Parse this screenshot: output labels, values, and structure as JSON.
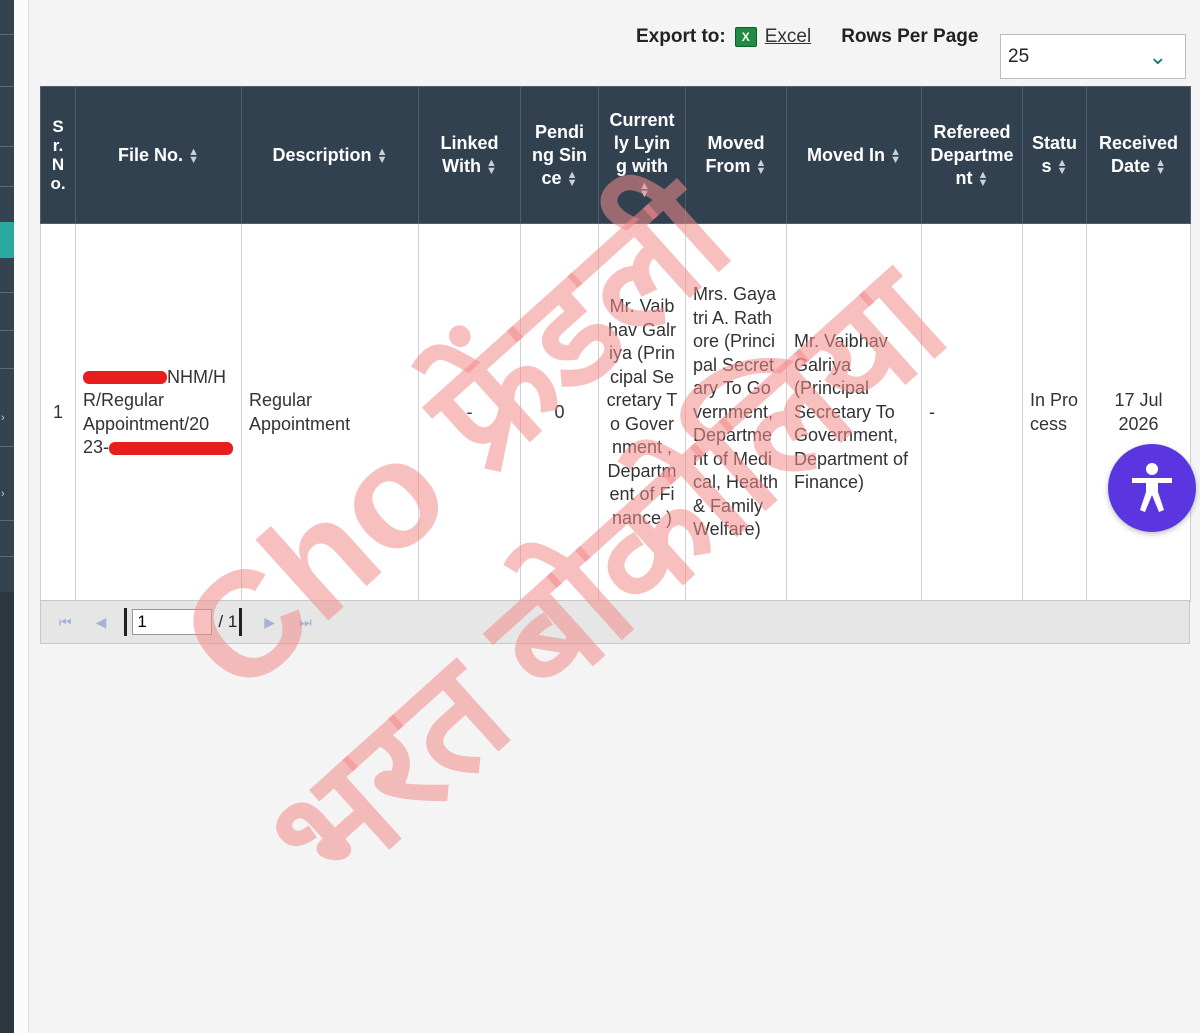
{
  "toolbar": {
    "export_label": "Export to:",
    "excel_label": "Excel",
    "excel_icon_glyph": "X",
    "rows_per_page_label": "Rows Per Page",
    "rows_per_page_value": "25"
  },
  "table": {
    "columns": [
      {
        "label": "Sr. No.",
        "sortable": false
      },
      {
        "label": "File No.",
        "sortable": true
      },
      {
        "label": "Description",
        "sortable": true
      },
      {
        "label": "Linked With",
        "sortable": true
      },
      {
        "label": "Pending Since",
        "sortable": true
      },
      {
        "label": "Currently Lying with",
        "sortable": true
      },
      {
        "label": "Moved From",
        "sortable": true
      },
      {
        "label": "Moved In",
        "sortable": true
      },
      {
        "label": "Refereed Department",
        "sortable": true
      },
      {
        "label": "Status",
        "sortable": true
      },
      {
        "label": "Received Date",
        "sortable": true
      }
    ],
    "rows": [
      {
        "sr_no": "1",
        "file_no_part1": "NHM/H",
        "file_no_part2": "R/Regular",
        "file_no_part3": "Appointment/20",
        "file_no_part4": "23-",
        "description": "Regular Appointment",
        "linked_with": "-",
        "pending_since": "0",
        "currently_lying_with": "Mr. Vaibhav Galriya (Principal Secretary To Government , Department of Finance )",
        "moved_from": "Mrs. Gayatri A. Rathore (Principal Secretary To Government, Department of Medical, Health & Family Welfare)",
        "moved_in": "Mr. Vaibhav Galriya (Principal Secretary To Government, Department of Finance)",
        "refereed_department": "-",
        "status": "In Process",
        "received_date": "17 Jul 2026"
      }
    ]
  },
  "pager": {
    "current_page": "1",
    "total_pages": "/ 1"
  },
  "watermark": {
    "line1": "Cho फ्रेंडली",
    "line2": "भरत बोकोलिया",
    "color": "#f28b8b"
  },
  "colors": {
    "header_bg": "#314150",
    "accent_teal": "#2ba9a0",
    "accessibility_button": "#5b36e0",
    "redaction": "#e81d1d"
  }
}
